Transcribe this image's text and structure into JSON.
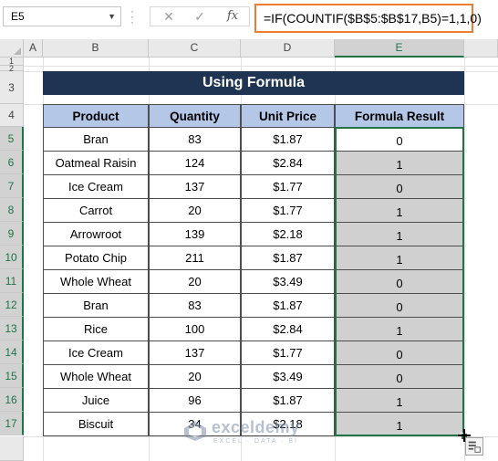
{
  "formula_bar": {
    "name_box": "E5",
    "formula": "=IF(COUNTIF($B$5:$B$17,B5)=1,1,0)"
  },
  "columns": [
    "A",
    "B",
    "C",
    "D",
    "E"
  ],
  "selected_column": "E",
  "rows": [
    "1",
    "2",
    "3",
    "4",
    "5",
    "6",
    "7",
    "8",
    "9",
    "10",
    "11",
    "12",
    "13",
    "14",
    "15",
    "16",
    "17"
  ],
  "title": "Using Formula",
  "table": {
    "headers": [
      "Product",
      "Quantity",
      "Unit Price",
      "Formula Result"
    ],
    "rows": [
      [
        "Bran",
        "83",
        "$1.87",
        "0"
      ],
      [
        "Oatmeal Raisin",
        "124",
        "$2.84",
        "1"
      ],
      [
        "Ice Cream",
        "137",
        "$1.77",
        "0"
      ],
      [
        "Carrot",
        "20",
        "$1.77",
        "1"
      ],
      [
        "Arrowroot",
        "139",
        "$2.18",
        "1"
      ],
      [
        "Potato Chip",
        "211",
        "$1.87",
        "1"
      ],
      [
        "Whole Wheat",
        "20",
        "$3.49",
        "0"
      ],
      [
        "Bran",
        "83",
        "$1.87",
        "0"
      ],
      [
        "Rice",
        "100",
        "$2.84",
        "1"
      ],
      [
        "Ice Cream",
        "137",
        "$1.77",
        "0"
      ],
      [
        "Whole Wheat",
        "20",
        "$3.49",
        "0"
      ],
      [
        "Juice",
        "96",
        "$1.87",
        "1"
      ],
      [
        "Biscuit",
        "34",
        "$2.18",
        "1"
      ]
    ]
  },
  "watermark": {
    "name": "exceldemy",
    "tagline": "EXCEL · DATA · BI"
  },
  "colors": {
    "title_bg": "#1f3352",
    "header_bg": "#b4c7e7",
    "result_bg": "#d0d0d0",
    "selection": "#217346",
    "formula_highlight": "#ed7d31"
  }
}
